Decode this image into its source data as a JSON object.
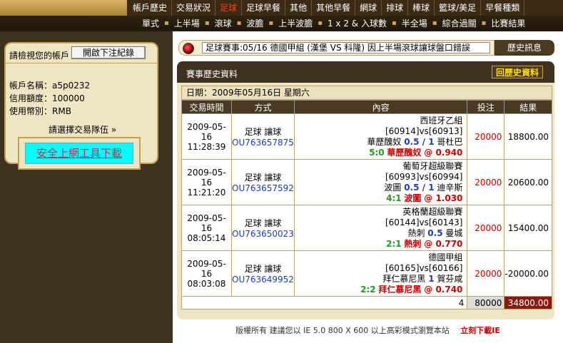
{
  "topnav": {
    "items": [
      "帳戶歷史",
      "交易狀況",
      "足球",
      "足球早餐",
      "其他",
      "其他早餐",
      "網球",
      "排球",
      "棒球",
      "籃球/美足",
      "早餐種類"
    ],
    "active_index": 2
  },
  "subnav": {
    "items": [
      "單式",
      "上半場",
      "滾球",
      "波膽",
      "上半波膽",
      "1 x 2 & 入球數",
      "半全場",
      "綜合過關",
      "比賽結果"
    ]
  },
  "account": {
    "check_label": "請檢視您的帳戶",
    "bet_log_button": "開啟下注紀錄",
    "account_name": "帳戶名稱：a5p0232",
    "credit_limit": "信用額度：100000",
    "currency": "使用幣別：RMB",
    "pick_team": "請選擇交易隊伍 »"
  },
  "download_button": "安全上網工具下載",
  "ticker": {
    "text": "足球賽事:05/16 德國甲組 (漢堡 VS 科隆) 因上半場滾球讓球盤口錯誤"
  },
  "history_tab": "歷史訊息",
  "panel": {
    "title": "賽事歷史資料",
    "back_button": "回歷史資料",
    "date": "日期：2009年05月16日 星期六"
  },
  "table": {
    "headers": [
      "交易時間",
      "方式",
      "內容",
      "投注",
      "結果"
    ],
    "rows": [
      {
        "date": "2009-05-16",
        "time": "11:28:39",
        "type": "足球 讓球",
        "id": "OU763657875",
        "league": "西班牙乙組",
        "ids": "[60914]vs[60913]",
        "home": "華歷醜奴",
        "line": "0.5 / 1",
        "away": "哥杜巴",
        "score": "5:0",
        "pick": "華歷醜奴",
        "odds": "@ 0.940",
        "stake": "20000",
        "result": "18800.00"
      },
      {
        "date": "2009-05-16",
        "time": "11:21:20",
        "type": "足球 讓球",
        "id": "OU763657592",
        "league": "葡萄牙超級聯賽",
        "ids": "[60993]vs[60994]",
        "home": "波圖",
        "line": "0.5 / 1",
        "away": "迪辛斯",
        "score": "4:1",
        "pick": "波圖",
        "odds": "@ 1.030",
        "stake": "20000",
        "result": "20600.00"
      },
      {
        "date": "2009-05-16",
        "time": "08:05:14",
        "type": "足球 讓球",
        "id": "OU763650023",
        "league": "英格蘭超級聯賽",
        "ids": "[60144]vs[60143]",
        "home": "熱刺",
        "line": "0.5",
        "away": "曼城",
        "score": "2:1",
        "pick": "熱刺",
        "odds": "@ 0.770",
        "stake": "20000",
        "result": "15400.00"
      },
      {
        "date": "2009-05-16",
        "time": "08:03:08",
        "type": "足球 讓球",
        "id": "OU763649952",
        "league": "德國甲組",
        "ids": "[60165]vs[60166]",
        "home": "拜仁慕尼黑",
        "line": "1",
        "away": "賀芬咸",
        "score": "2:2",
        "pick": "拜仁慕尼黑",
        "odds": "@ 0.740",
        "stake": "20000",
        "result": "-20000.00"
      }
    ],
    "total": {
      "count": "4",
      "stake": "80000",
      "result": "34800.00"
    }
  },
  "footer": {
    "text": "版權所有 建議您以 IE 5.0 800 X 600 以上高彩模式瀏覽本站",
    "download_ie": "立刻下載IE"
  }
}
